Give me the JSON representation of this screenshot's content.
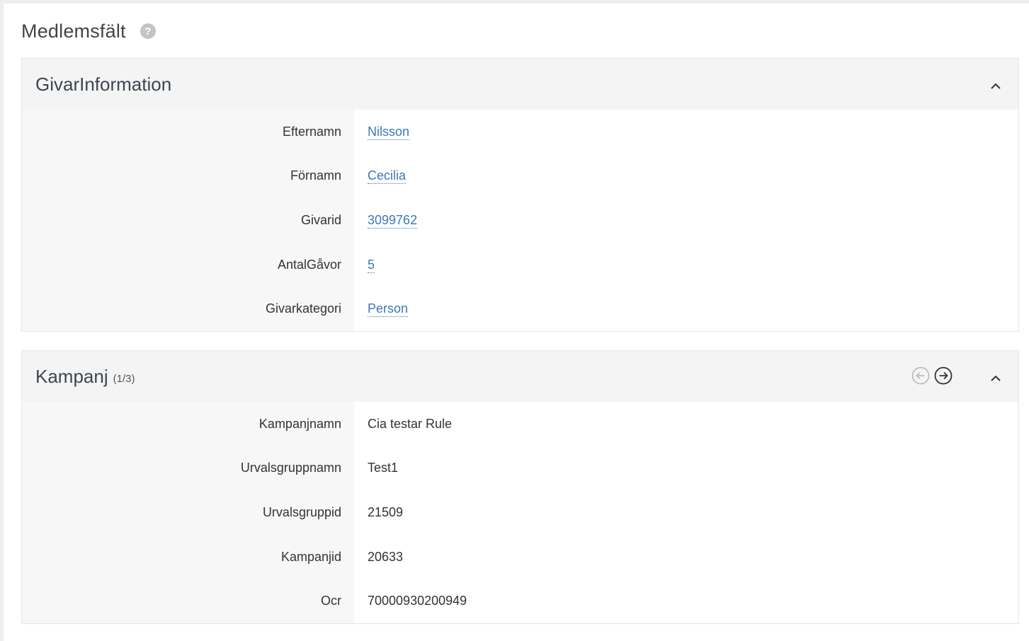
{
  "page": {
    "title": "Medlemsfält",
    "help_icon": "?"
  },
  "givar_panel": {
    "title": "GivarInformation",
    "fields": [
      {
        "label": "Efternamn",
        "value": "Nilsson"
      },
      {
        "label": "Förnamn",
        "value": "Cecilia"
      },
      {
        "label": "Givarid",
        "value": "3099762"
      },
      {
        "label": "AntalGåvor",
        "value": "5"
      },
      {
        "label": "Givarkategori",
        "value": "Person"
      }
    ]
  },
  "kampanj_panel": {
    "title": "Kampanj",
    "counter": "(1/3)",
    "fields": [
      {
        "label": "Kampanjnamn",
        "value": "Cia testar Rule"
      },
      {
        "label": "Urvalsgruppnamn",
        "value": "Test1"
      },
      {
        "label": "Urvalsgruppid",
        "value": "21509"
      },
      {
        "label": "Kampanjid",
        "value": "20633"
      },
      {
        "label": "Ocr",
        "value": "70000930200949"
      }
    ]
  },
  "icons": {
    "help": "question-circle-icon",
    "collapse": "chevron-up-icon",
    "prev": "arrow-left-circle-icon",
    "next": "arrow-right-circle-icon"
  },
  "colors": {
    "link": "#3b78b8",
    "panel_bg": "#f4f4f4",
    "disabled_icon": "#b5b5b5",
    "active_icon": "#333333"
  }
}
